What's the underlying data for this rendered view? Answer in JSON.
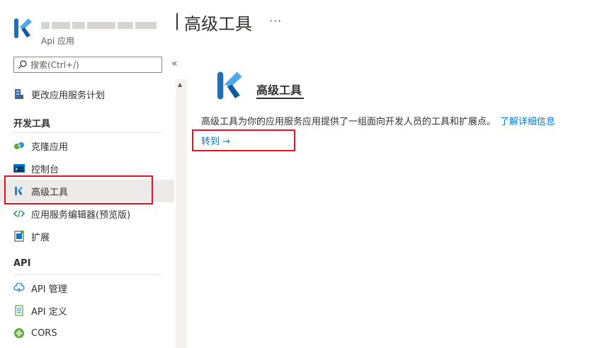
{
  "header": {
    "separator": "|",
    "title": "高级工具",
    "more_label": "···",
    "subtitle": "Api 应用"
  },
  "search": {
    "placeholder": "搜索(Ctrl+/)"
  },
  "sidebar": {
    "collapse_label": "«",
    "scroll_up": "▲",
    "items": [
      {
        "label": "更改应用服务计划",
        "icon": "app-service-plan-icon"
      },
      {
        "label": "克隆应用",
        "icon": "clone-icon"
      },
      {
        "label": "控制台",
        "icon": "console-icon"
      },
      {
        "label": "高级工具",
        "icon": "kudu-icon"
      },
      {
        "label": "应用服务编辑器(预览版)",
        "icon": "code-editor-icon"
      },
      {
        "label": "扩展",
        "icon": "extensions-icon"
      },
      {
        "label": "API 管理",
        "icon": "api-management-icon"
      },
      {
        "label": "API 定义",
        "icon": "api-definition-icon"
      },
      {
        "label": "CORS",
        "icon": "cors-icon"
      }
    ],
    "sections": [
      {
        "label": "开发工具"
      },
      {
        "label": "API"
      }
    ]
  },
  "content": {
    "title": "高级工具",
    "description": "高级工具为你的应用服务应用提供了一组面向开发人员的工具和扩展点。",
    "learn_more": "了解详细信息",
    "go_link": "转到 →"
  },
  "colors": {
    "accent": "#0078d4",
    "highlight": "#e81123",
    "active_bg": "#edebe9"
  }
}
